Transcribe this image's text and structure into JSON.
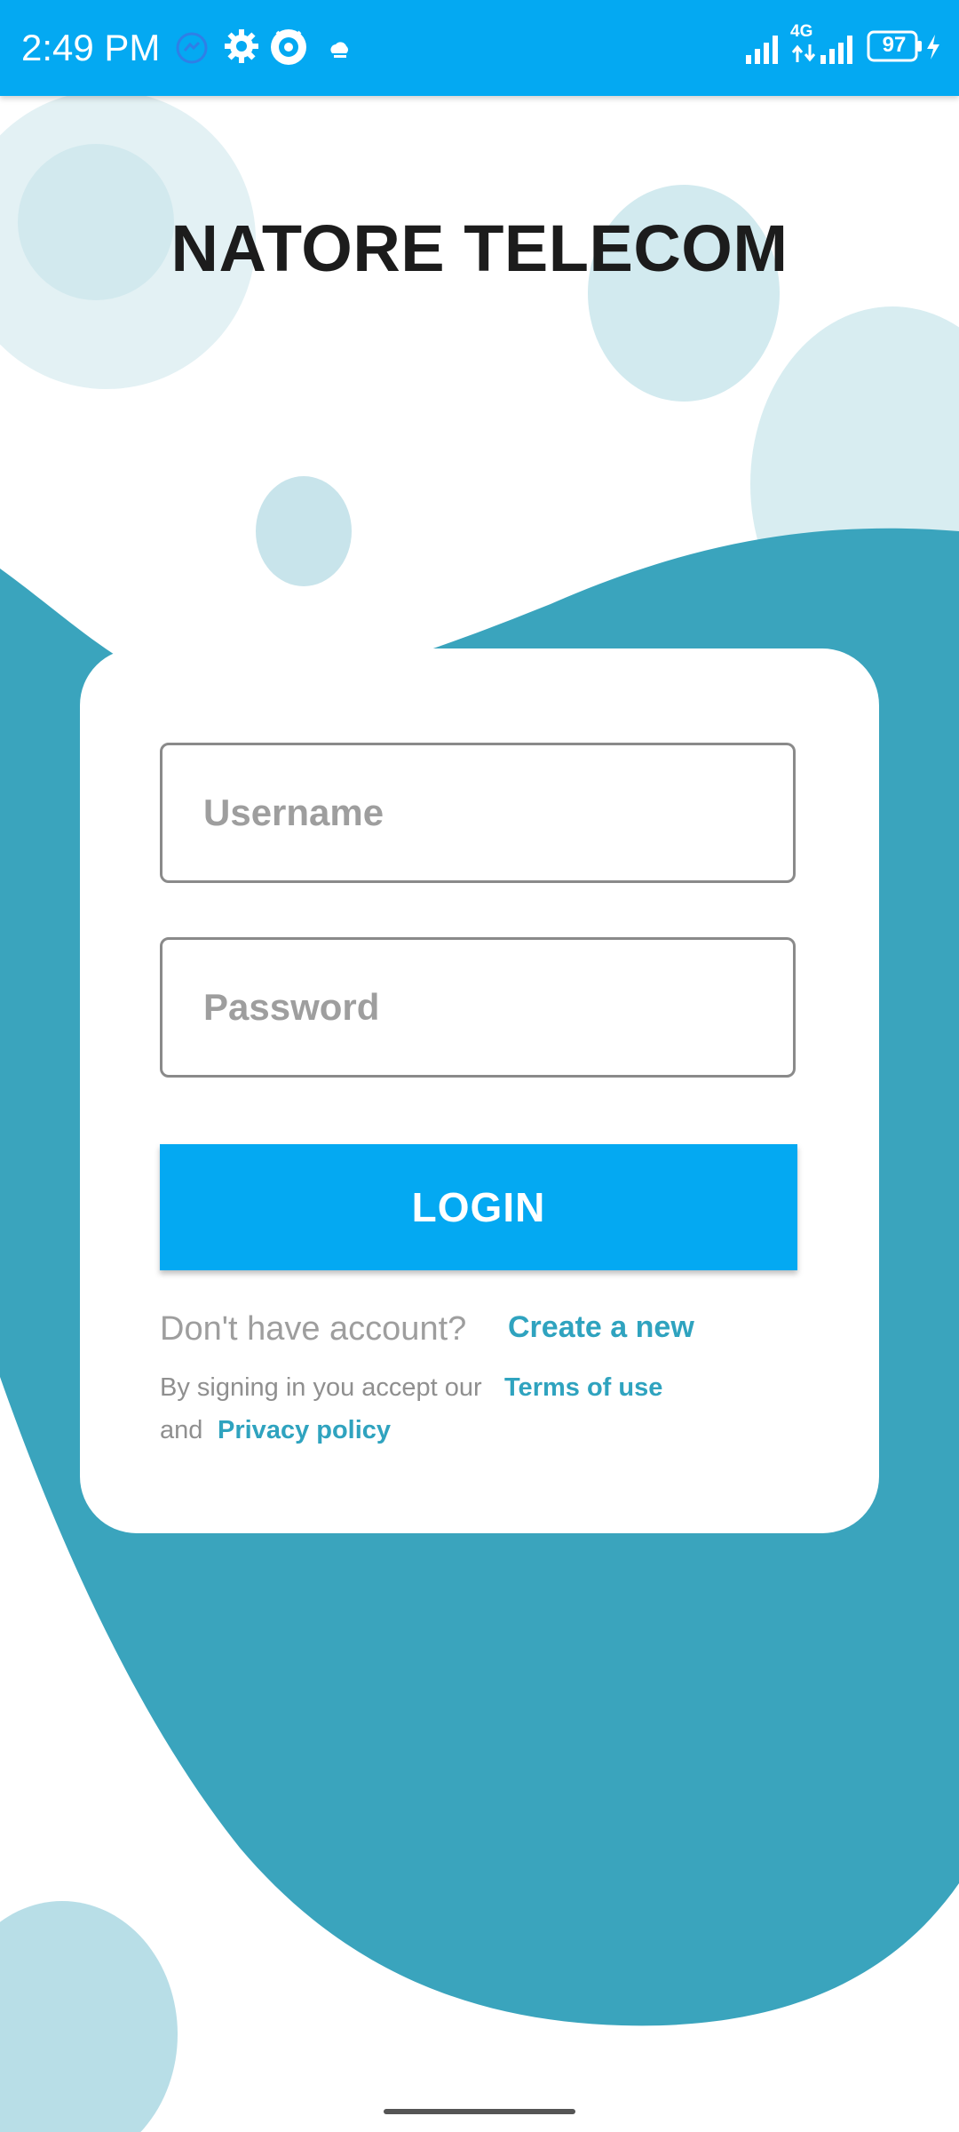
{
  "status_bar": {
    "time": "2:49 PM",
    "network_label": "4G",
    "battery_level": "97",
    "icons": [
      "messenger-icon",
      "gear-icon",
      "browser-icon",
      "cloud-icon",
      "signal-icon",
      "signal-icon",
      "battery-icon",
      "charging-icon"
    ]
  },
  "app": {
    "title": "NATORE TELECOM"
  },
  "login_form": {
    "username_placeholder": "Username",
    "password_placeholder": "Password",
    "login_button": "LOGIN",
    "no_account_text": "Don't have account?",
    "create_account_link": "Create a new",
    "terms_prefix": "By signing in you accept our",
    "terms_link": "Terms of use",
    "and_text": "and",
    "privacy_link": "Privacy policy"
  },
  "colors": {
    "status_bar": "#04A9F2",
    "button": "#04A9F2",
    "link": "#2FA3BF",
    "wave": "#3AA4BD",
    "bubble_light": "#D7EDF1"
  }
}
